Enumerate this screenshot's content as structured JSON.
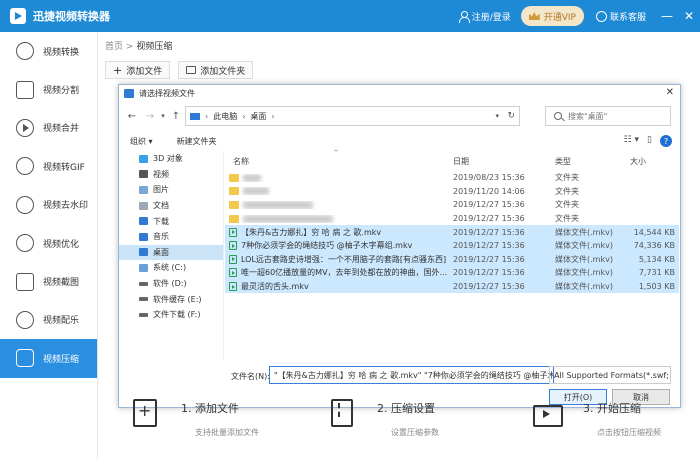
{
  "app": {
    "title": "迅捷视频转换器",
    "login": "注册/登录",
    "vip": "开通VIP",
    "support": "联系客服",
    "min_glyph": "—",
    "close_glyph": "✕"
  },
  "sidebar": {
    "items": [
      {
        "label": "视频转换",
        "icon": "video-convert-icon"
      },
      {
        "label": "视频分割",
        "icon": "video-split-icon"
      },
      {
        "label": "视频合并",
        "icon": "video-merge-icon"
      },
      {
        "label": "视频转GIF",
        "icon": "gif-icon"
      },
      {
        "label": "视频去水印",
        "icon": "watermark-icon"
      },
      {
        "label": "视频优化",
        "icon": "optimize-icon"
      },
      {
        "label": "视频截图",
        "icon": "screenshot-icon"
      },
      {
        "label": "视频配乐",
        "icon": "music-icon"
      },
      {
        "label": "视频压缩",
        "icon": "compress-icon",
        "active": true
      }
    ]
  },
  "breadcrumb": {
    "home": "首页",
    "sep": ">",
    "current": "视频压缩"
  },
  "toolbar": {
    "add_file": "添加文件",
    "add_folder": "添加文件夹",
    "plus": "+"
  },
  "dialog": {
    "title": "请选择视频文件",
    "close": "✕",
    "address": {
      "root": "此电脑",
      "sep": "›",
      "folder": "桌面"
    },
    "search_placeholder": "搜索\"桌面\"",
    "organize": "组织 ▾",
    "new_folder": "新建文件夹",
    "tree": [
      {
        "label": "3D 对象",
        "color": "#3aa0e8"
      },
      {
        "label": "视频",
        "color": "#555"
      },
      {
        "label": "图片",
        "color": "#7aa9d6"
      },
      {
        "label": "文档",
        "color": "#9aa8b8"
      },
      {
        "label": "下载",
        "color": "#2f7ad4"
      },
      {
        "label": "音乐",
        "color": "#2f7ad4"
      },
      {
        "label": "桌面",
        "color": "#2f7ad4",
        "selected": true
      },
      {
        "label": "系统 (C:)",
        "color": "#6aa0d8"
      },
      {
        "label": "软件 (D:)",
        "color": "#666"
      },
      {
        "label": "软件缓存 (E:)",
        "color": "#666"
      },
      {
        "label": "文件下载 (F:)",
        "color": "#666"
      }
    ],
    "columns": {
      "name": "名称",
      "date": "日期",
      "type": "类型",
      "size": "大小",
      "sort_caret": "^"
    },
    "folders": [
      {
        "date": "2019/08/23 15:36",
        "type": "文件夹"
      },
      {
        "date": "2019/11/20 14:06",
        "type": "文件夹"
      },
      {
        "date": "2019/12/27 15:36",
        "type": "文件夹"
      },
      {
        "date": "2019/12/27 15:36",
        "type": "文件夹"
      }
    ],
    "files": [
      {
        "name": "【朱丹&古力娜扎】穷 哈 病 之 歌.mkv",
        "date": "2019/12/27 15:36",
        "type": "媒体文件(.mkv)",
        "size": "14,544 KB"
      },
      {
        "name": "7种你必须学会的绳结技巧 @柚子木字幕组.mkv",
        "date": "2019/12/27 15:36",
        "type": "媒体文件(.mkv)",
        "size": "74,336 KB"
      },
      {
        "name": "LOL远古套路史诗增强：一个不用脑子的套路[有点骚东西]...",
        "date": "2019/12/27 15:36",
        "type": "媒体文件(.mkv)",
        "size": "5,134 KB"
      },
      {
        "name": "唯一超60亿播放量的MV，去年到处都在放的神曲，国外...",
        "date": "2019/12/27 15:36",
        "type": "媒体文件(.mkv)",
        "size": "7,731 KB"
      },
      {
        "name": "最灵活的舌头.mkv",
        "date": "2019/12/27 15:36",
        "type": "媒体文件(.mkv)",
        "size": "1,503 KB"
      }
    ],
    "filename_label": "文件名(N):",
    "filename_value": "\"【朱丹&古力娜扎】穷 哈 病 之 歌.mkv\" \"7种你必须学会的绳结技巧 @柚子木字幕组.mkv\"",
    "filetype_value": "All Supported Formats(*.swf;",
    "open": "打开(O)",
    "cancel": "取消"
  },
  "steps": [
    {
      "title": "1. 添加文件",
      "sub": "支持批量添加文件",
      "icon": "add-file-icon"
    },
    {
      "title": "2. 压缩设置",
      "sub": "设置压缩参数",
      "icon": "compress-settings-icon"
    },
    {
      "title": "3. 开始压缩",
      "sub": "点击按钮压缩视频",
      "icon": "start-compress-icon"
    }
  ]
}
